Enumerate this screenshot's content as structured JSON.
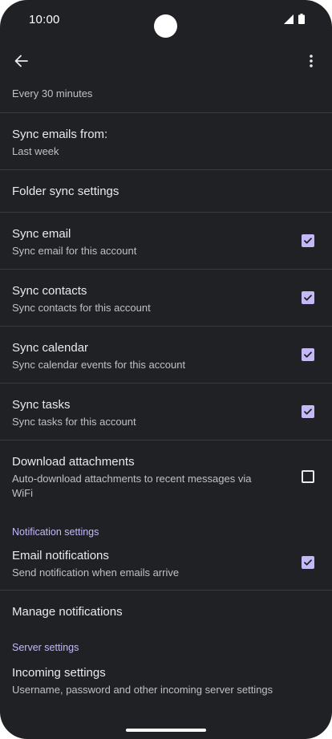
{
  "status": {
    "time": "10:00",
    "icons": [
      "cellular-signal-icon",
      "battery-icon"
    ]
  },
  "toolbar": {
    "back_icon": "arrow-back-icon",
    "more_icon": "more-vert-icon"
  },
  "sync_interval": {
    "value": "Every 30 minutes"
  },
  "sync_emails_from": {
    "title": "Sync emails from:",
    "value": "Last week"
  },
  "folder_sync": {
    "title": "Folder sync settings"
  },
  "toggles": [
    {
      "title": "Sync email",
      "subtitle": "Sync email for this account",
      "checked": true
    },
    {
      "title": "Sync contacts",
      "subtitle": "Sync contacts for this account",
      "checked": true
    },
    {
      "title": "Sync calendar",
      "subtitle": "Sync calendar events for this account",
      "checked": true
    },
    {
      "title": "Sync tasks",
      "subtitle": "Sync tasks for this account",
      "checked": true
    },
    {
      "title": "Download attachments",
      "subtitle": "Auto-download attachments to recent messages via WiFi",
      "checked": false
    }
  ],
  "notification_section": {
    "header": "Notification settings",
    "email_notifications": {
      "title": "Email notifications",
      "subtitle": "Send notification when emails arrive",
      "checked": true
    },
    "manage": {
      "title": "Manage notifications"
    }
  },
  "server_section": {
    "header": "Server settings",
    "incoming": {
      "title": "Incoming settings",
      "subtitle": "Username, password and other incoming server settings"
    }
  },
  "colors": {
    "background": "#202124",
    "accent": "#c4b9f6",
    "text_primary": "#e8eaed",
    "text_secondary": "#bdc1c6",
    "divider": "#3a3b3e"
  }
}
